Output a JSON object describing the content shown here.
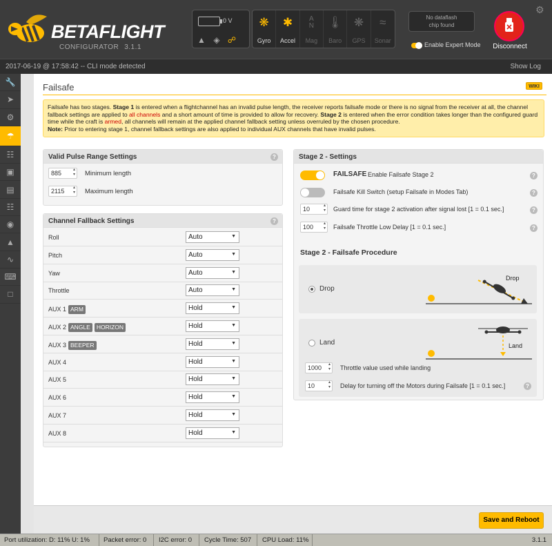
{
  "app": {
    "logo_title": "BETAFLIGHT",
    "logo_subtitle": "CONFIGURATOR",
    "version": "3.1.1"
  },
  "header": {
    "battery_voltage": "0 V",
    "sensors": [
      {
        "label": "Gyro",
        "icon": "gyro-icon",
        "active": true
      },
      {
        "label": "Accel",
        "icon": "accel-icon",
        "active": true
      },
      {
        "label": "Mag",
        "icon": "mag-icon",
        "active": false
      },
      {
        "label": "Baro",
        "icon": "baro-icon",
        "active": false
      },
      {
        "label": "GPS",
        "icon": "gps-icon",
        "active": false
      },
      {
        "label": "Sonar",
        "icon": "sonar-icon",
        "active": false
      }
    ],
    "dataflash_line1": "No dataflash",
    "dataflash_line2": "chip found",
    "expert_mode_label": "Enable Expert Mode",
    "disconnect_label": "Disconnect"
  },
  "status": {
    "log_line": "2017-06-19 @ 17:58:42 -- CLI mode detected",
    "show_log": "Show Log"
  },
  "tab": {
    "title": "Failsafe",
    "wiki": "WIKI"
  },
  "note": {
    "p1_a": "Failsafe has two stages. ",
    "p1_stage1": "Stage 1",
    "p1_b": " is entered when a flightchannel has an invalid pulse length, the receiver reports failsafe mode or there is no signal from the receiver at all, the channel fallback settings are applied to ",
    "p1_all_channels": "all channels",
    "p1_c": " and a short amount of time is provided to allow for recovery. ",
    "p1_stage2": "Stage 2",
    "p1_d": " is entered when the error condition takes longer than the configured guard time while the craft is ",
    "p1_armed": "armed",
    "p1_e": ", all channels will remain at the applied channel fallback setting unless overruled by the chosen procedure.",
    "p2_label": "Note:",
    "p2_text": " Prior to entering stage 1, channel fallback settings are also applied to individual AUX channels that have invalid pulses."
  },
  "pulse_range": {
    "title": "Valid Pulse Range Settings",
    "min_value": "885",
    "min_label": "Minimum length",
    "max_value": "2115",
    "max_label": "Maximum length"
  },
  "fallback": {
    "title": "Channel Fallback Settings",
    "rows": [
      {
        "label": "Roll",
        "badges": [],
        "value": "Auto"
      },
      {
        "label": "Pitch",
        "badges": [],
        "value": "Auto"
      },
      {
        "label": "Yaw",
        "badges": [],
        "value": "Auto"
      },
      {
        "label": "Throttle",
        "badges": [],
        "value": "Auto"
      },
      {
        "label": "AUX 1",
        "badges": [
          "ARM"
        ],
        "value": "Hold"
      },
      {
        "label": "AUX 2",
        "badges": [
          "ANGLE",
          "HORIZON"
        ],
        "value": "Hold"
      },
      {
        "label": "AUX 3",
        "badges": [
          "BEEPER"
        ],
        "value": "Hold"
      },
      {
        "label": "AUX 4",
        "badges": [],
        "value": "Hold"
      },
      {
        "label": "AUX 5",
        "badges": [],
        "value": "Hold"
      },
      {
        "label": "AUX 6",
        "badges": [],
        "value": "Hold"
      },
      {
        "label": "AUX 7",
        "badges": [],
        "value": "Hold"
      },
      {
        "label": "AUX 8",
        "badges": [],
        "value": "Hold"
      }
    ]
  },
  "stage2": {
    "title": "Stage 2 - Settings",
    "failsafe_title": "FAILSAFE",
    "failsafe_label": "Enable Failsafe Stage 2",
    "kill_switch_label": "Failsafe Kill Switch (setup Failsafe in Modes Tab)",
    "guard_value": "10",
    "guard_label": "Guard time for stage 2 activation after signal lost [1 = 0.1 sec.]",
    "throttle_delay_value": "100",
    "throttle_delay_label": "Failsafe Throttle Low Delay [1 = 0.1 sec.]",
    "procedure_title": "Stage 2 - Failsafe Procedure",
    "drop_label": "Drop",
    "drop_diagram_label": "Drop",
    "land_label": "Land",
    "land_diagram_label": "Land",
    "land_throttle_value": "1000",
    "land_throttle_label": "Throttle value used while landing",
    "land_delay_value": "10",
    "land_delay_label": "Delay for turning off the Motors during Failsafe [1 = 0.1 sec.]"
  },
  "actions": {
    "save_reboot": "Save and Reboot"
  },
  "footer": {
    "port_util": "Port utilization: D: 11% U: 1%",
    "packet_error": "Packet error: 0",
    "i2c_error": "I2C error: 0",
    "cycle_time": "Cycle Time: 507",
    "cpu_load": "CPU Load: 11%",
    "version": "3.1.1"
  },
  "sidebar": {
    "items": [
      {
        "icon": "wrench-icon"
      },
      {
        "icon": "plug-icon"
      },
      {
        "icon": "gear-icon"
      },
      {
        "icon": "parachute-icon",
        "active": true
      },
      {
        "icon": "network-icon"
      },
      {
        "icon": "receiver-icon"
      },
      {
        "icon": "modes-icon"
      },
      {
        "icon": "sliders-icon"
      },
      {
        "icon": "motor-icon"
      },
      {
        "icon": "led-icon"
      },
      {
        "icon": "sensors-icon"
      },
      {
        "icon": "tethered-icon"
      },
      {
        "icon": "cli-icon"
      }
    ]
  },
  "colors": {
    "accent": "#ffbb00",
    "header_bg": "#3c3c3c",
    "disconnect_red": "#e2231a"
  }
}
